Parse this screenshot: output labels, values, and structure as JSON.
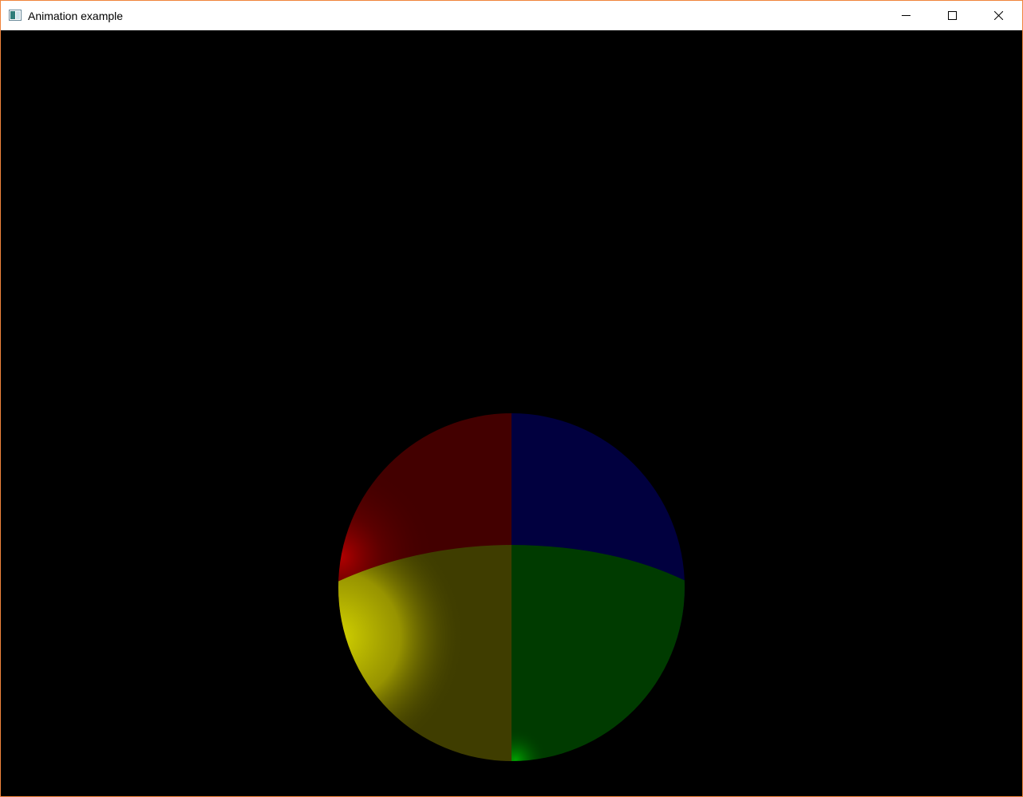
{
  "window": {
    "title": "Animation example",
    "border_color": "#f0843c"
  },
  "titlebar": {
    "icons": {
      "app": "application-window-icon",
      "minimize": "minimize-icon",
      "maximize": "maximize-icon",
      "close": "close-icon"
    }
  },
  "scene": {
    "background": "#000000",
    "sphere_colors": {
      "top_left": "#430000",
      "top_right": "#01003f",
      "bottom_left": "#3f3d00",
      "bottom_right": "#003b00",
      "highlight_red": "#c00000",
      "highlight_yellow": "#dcdc00",
      "highlight_green": "#00b000"
    }
  }
}
